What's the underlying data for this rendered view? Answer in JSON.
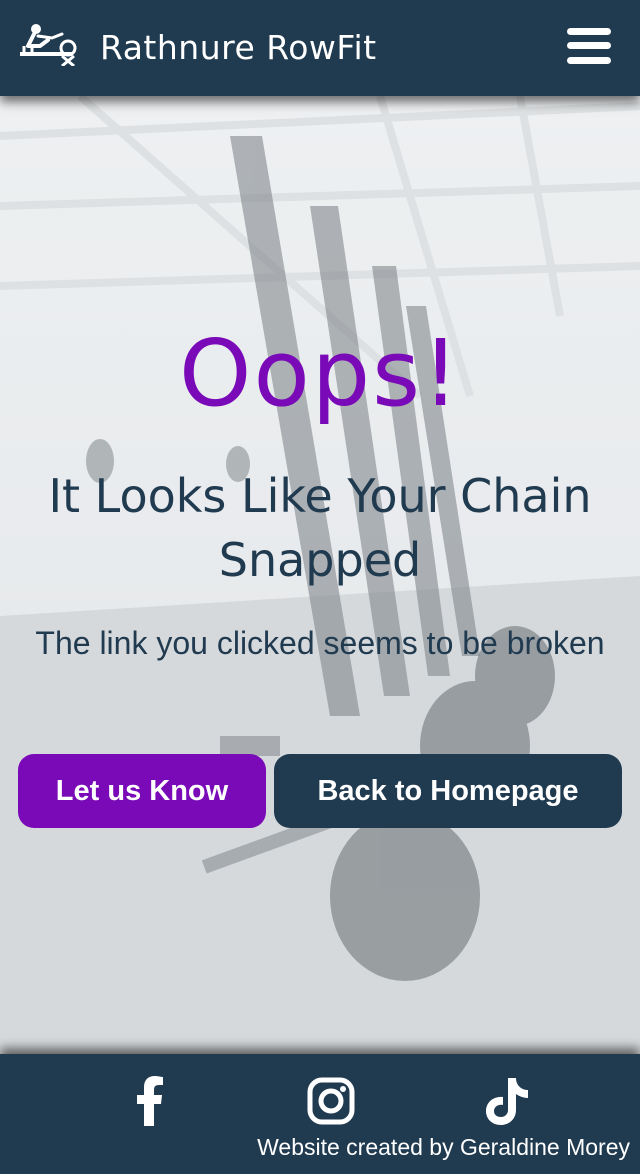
{
  "header": {
    "brand": "Rathnure RowFit",
    "logo_icon": "rowing-machine-icon",
    "menu_icon": "hamburger-menu-icon"
  },
  "hero": {
    "background": "gym-rowing-machines-photo"
  },
  "main": {
    "title": "Oops!",
    "headline": "It Looks Like Your Chain Snapped",
    "subtext": "The link you clicked seems to be broken",
    "buttons": {
      "primary": "Let us Know",
      "secondary": "Back to Homepage"
    }
  },
  "footer": {
    "social": [
      "facebook-icon",
      "instagram-icon",
      "tiktok-icon"
    ],
    "credit": "Website created by Geraldine Morey"
  },
  "colors": {
    "navy": "#203a50",
    "purple": "#7a0ab8",
    "white": "#ffffff"
  }
}
